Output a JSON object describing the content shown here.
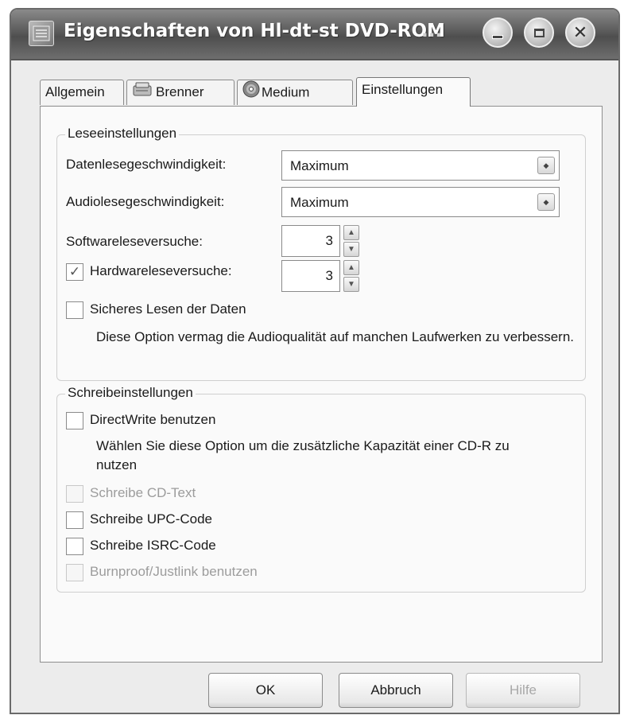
{
  "window": {
    "title": "Eigenschaften von Hl-dt-st DVD-ROM",
    "title_overflow": "...",
    "icons": {
      "app": "drive-icon",
      "minimize": "minimize-icon",
      "maximize": "maximize-icon",
      "close": "close-icon"
    }
  },
  "tabs": [
    {
      "label": "Allgemein",
      "icon": null,
      "active": false
    },
    {
      "label": "Brenner",
      "icon": "burner-icon",
      "active": false
    },
    {
      "label": "Medium",
      "icon": "disc-icon",
      "active": false
    },
    {
      "label": "Einstellungen",
      "icon": null,
      "active": true
    }
  ],
  "read_settings": {
    "legend": "Leseeinstellungen",
    "data_speed": {
      "label": "Datenlesegeschwindigkeit:",
      "value": "Maximum"
    },
    "audio_speed": {
      "label": "Audiolesegeschwindigkeit:",
      "value": "Maximum"
    },
    "software_retries": {
      "label": "Softwareleseversuche:",
      "value": "3"
    },
    "hardware_retries": {
      "label": "Hardwareleseversuche:",
      "value": "3",
      "checked": true
    },
    "secure_read": {
      "label": "Sicheres Lesen der Daten",
      "checked": false,
      "description": "Diese Option vermag die Audioqualität auf manchen Laufwerken zu verbessern."
    }
  },
  "write_settings": {
    "legend": "Schreibeinstellungen",
    "direct_write": {
      "label": "DirectWrite benutzen",
      "checked": false,
      "description": "Wählen Sie diese Option um die zusätzliche Kapazität einer CD-R zu nutzen"
    },
    "cd_text": {
      "label": "Schreibe CD-Text",
      "checked": false,
      "enabled": false
    },
    "upc_code": {
      "label": "Schreibe UPC-Code",
      "checked": false,
      "enabled": true
    },
    "isrc_code": {
      "label": "Schreibe ISRC-Code",
      "checked": false,
      "enabled": true
    },
    "bumproof": {
      "label": "Burnproof/Justlink benutzen",
      "checked": false,
      "enabled": false
    }
  },
  "buttons": {
    "ok": "OK",
    "cancel": "Abbruch",
    "help": "Hilfe"
  },
  "glyphs": {
    "check": "✓",
    "arrow_up": "▲",
    "arrow_down": "▼",
    "combo_arrow": "◆",
    "close": "✕"
  }
}
